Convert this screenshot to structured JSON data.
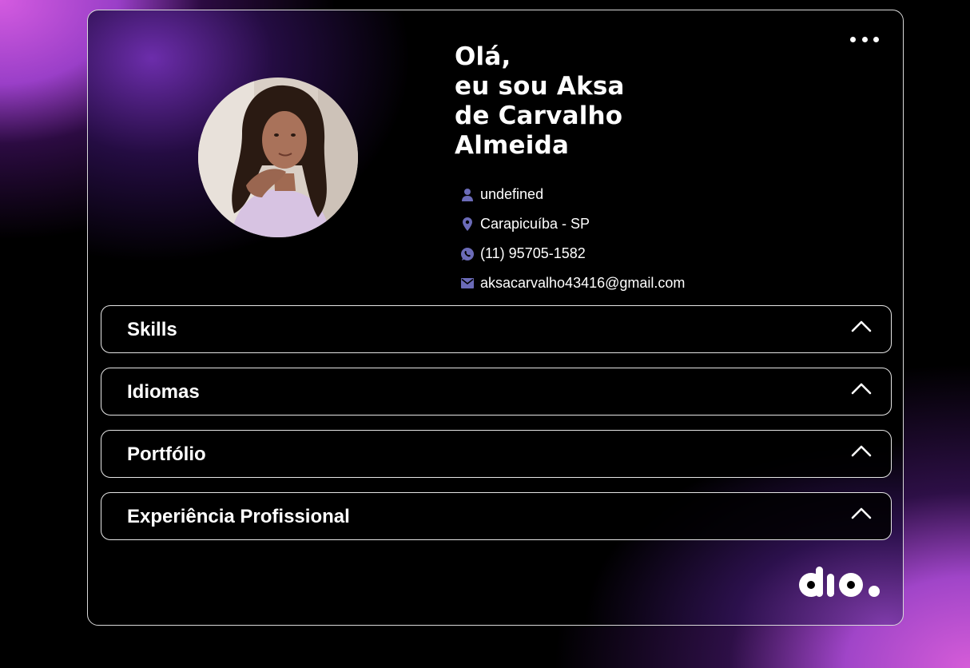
{
  "header": {
    "greeting_lines": [
      "Olá,",
      "eu sou Aksa",
      "de Carvalho",
      "Almeida"
    ]
  },
  "profile": {
    "avatar_alt": "Aksa de Carvalho Almeida"
  },
  "info": {
    "job": "undefined",
    "location": "Carapicuíba - SP",
    "phone": "(11) 95705-1582",
    "email": "aksacarvalho43416@gmail.com"
  },
  "sections": [
    {
      "label": "Skills",
      "expanded": true
    },
    {
      "label": "Idiomas",
      "expanded": true
    },
    {
      "label": "Portfólio",
      "expanded": true
    },
    {
      "label": "Experiência Profissional",
      "expanded": true
    }
  ],
  "icons": {
    "more": "more-horizontal-icon",
    "person": "person-icon",
    "location": "location-pin-icon",
    "phone": "whatsapp-icon",
    "email": "email-icon",
    "chevron": "chevron-up-icon"
  },
  "colors": {
    "icon_accent": "#6b6bb8",
    "border": "#e6e6e6",
    "gradient_pink": "#d45be0",
    "gradient_purple": "#9a3fc8"
  },
  "brand": {
    "logo_text": "dio."
  }
}
